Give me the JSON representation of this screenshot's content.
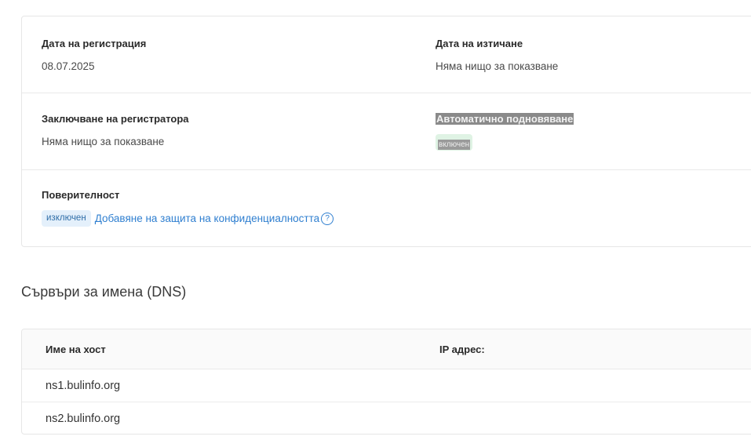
{
  "details": {
    "registration_date": {
      "label": "Дата на регистрация",
      "value": "08.07.2025"
    },
    "expiration_date": {
      "label": "Дата на изтичане",
      "value": "Няма нищо за показване"
    },
    "registrar_lock": {
      "label": "Заключване на регистратора",
      "value": "Няма нищо за показване"
    },
    "auto_renew": {
      "label": "Автоматично подновяване",
      "status": "включен"
    },
    "privacy": {
      "label": "Поверителност",
      "status": "изключен",
      "add_link": "Добавяне на защита на конфиденциалността",
      "help": "?"
    }
  },
  "dns": {
    "title": "Сървъри за имена (DNS)",
    "columns": [
      "Име на хост",
      "IP адрес:"
    ],
    "rows": [
      {
        "host": "ns1.bulinfo.org",
        "ip": ""
      },
      {
        "host": "ns2.bulinfo.org",
        "ip": ""
      }
    ]
  },
  "colors": {
    "link": "#2f7fd0",
    "badge_on_bg": "#dff3e4",
    "badge_off_bg": "#e4f0fb"
  }
}
